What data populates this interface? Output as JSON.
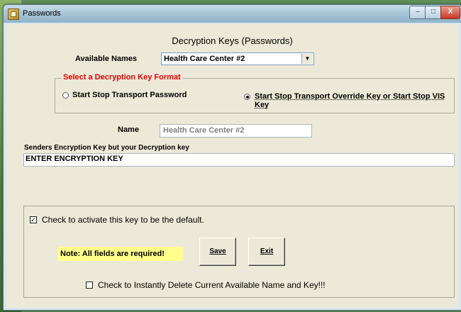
{
  "window": {
    "title": "Passwords",
    "min_glyph": "–",
    "max_glyph": "□",
    "close_glyph": "X"
  },
  "heading": "Decryption Keys (Passwords)",
  "available_names": {
    "label": "Available Names",
    "value": "Health Care Center #2",
    "arrow": "▼"
  },
  "key_format": {
    "title": "Select a Decryption Key Format",
    "option_password": "Start Stop Transport Password",
    "option_override": "Start Stop Transport Override Key or Start Stop VIS Key",
    "selected": "option_override"
  },
  "name_field": {
    "label": "Name",
    "value": "Health Care Center #2"
  },
  "encryption_key": {
    "label": "Senders Encryption Key but your Decryption key",
    "value": "ENTER ENCRYPTION KEY"
  },
  "default_key": {
    "label": "Check to activate this key to be the default.",
    "checked": true,
    "check_glyph": "✓"
  },
  "note": "Note: All fields are required!",
  "buttons": {
    "save": "Save",
    "exit": "Exit"
  },
  "delete_option": {
    "label": "Check to Instantly Delete Current Available Name and Key!!!",
    "checked": false
  },
  "colors": {
    "group_title": "#e00000",
    "note_bg": "#ffff8c",
    "client_bg": "#ece9d8"
  }
}
